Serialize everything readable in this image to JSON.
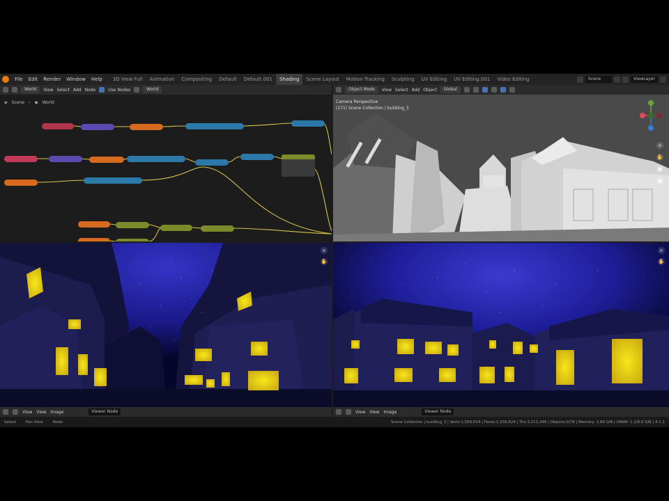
{
  "topbar": {
    "menus": [
      "File",
      "Edit",
      "Render",
      "Window",
      "Help"
    ],
    "workspaces": [
      "3D View Full",
      "Animation",
      "Compositing",
      "Default",
      "Default.001",
      "Shading",
      "Scene Layout",
      "Motion Tracking",
      "Sculpting",
      "UV Editing",
      "UV Editing.001",
      "Video Editing"
    ],
    "active_workspace": "Shading",
    "scene": "Scene",
    "view_layer": "ViewLayer"
  },
  "node_editor": {
    "world_label": "World",
    "world_name": "World",
    "use_nodes_label": "Use Nodes",
    "view_menu": "View",
    "select_menu": "Select",
    "add_menu": "Add",
    "node_menu": "Node",
    "breadcrumb_scene": "Scene",
    "breadcrumb_world": "World"
  },
  "viewport": {
    "mode": "Object Mode",
    "menus": [
      "View",
      "Select",
      "Add",
      "Object"
    ],
    "transform": "Global",
    "title": "Camera Perspective",
    "subtitle": "(171) Scene Collection | building_3"
  },
  "image_editor_left": {
    "menus": [
      "View",
      "View",
      "Image"
    ],
    "image_name": "Viewer Node"
  },
  "image_editor_right": {
    "menus": [
      "View",
      "View",
      "Image"
    ],
    "image_name": "Viewer Node"
  },
  "statusbar": {
    "left": "Select",
    "mid1": "Pan View",
    "mid2": "Node",
    "stats": "Scene Collection | building_3 | Verts:1,556,624 | Faces:1,556,624 | Tris:3,113,248 | Objects:0/78 | Memory: 1.68 GiB | VRAM: 1.2/8.0 GiB | 4.1.1"
  },
  "colors": {
    "accent": "#4772b3",
    "sky": "#2a2ab8",
    "window_glow": "#f7e81a",
    "wire": "#d8c44a"
  }
}
